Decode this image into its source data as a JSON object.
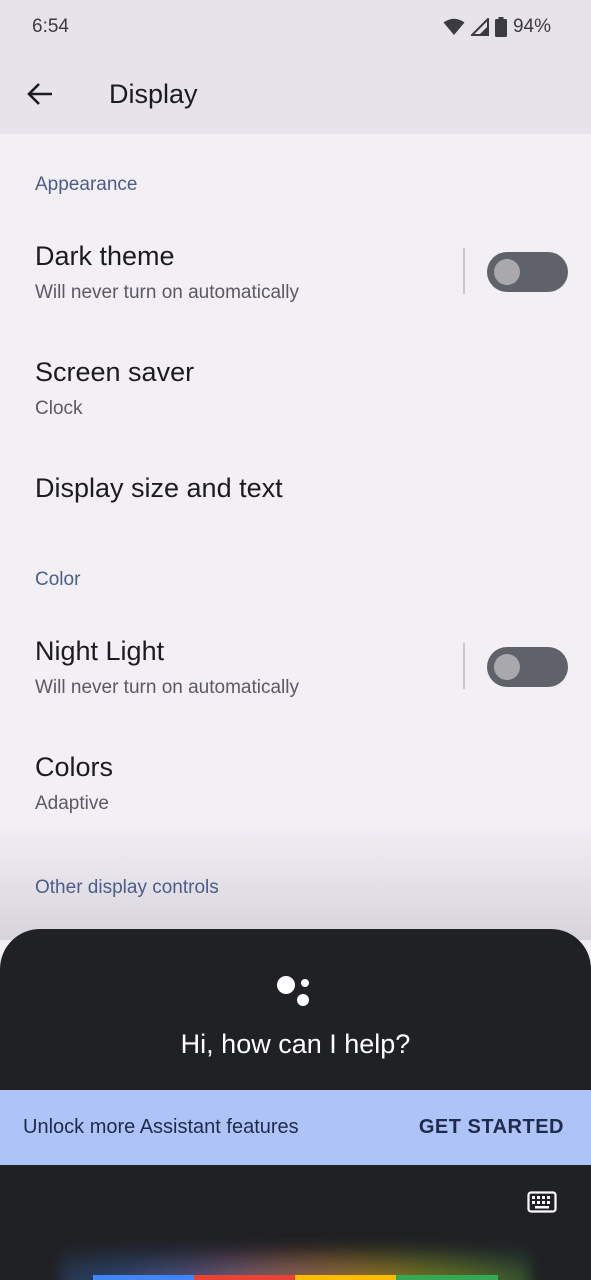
{
  "status_bar": {
    "time": "6:54",
    "battery": "94%",
    "icons": [
      "wifi-icon",
      "cell-signal-icon",
      "battery-icon"
    ]
  },
  "app_bar": {
    "title": "Display",
    "back_icon": "arrow-back-icon"
  },
  "sections": [
    {
      "header": "Appearance",
      "items": [
        {
          "title": "Dark theme",
          "summary": "Will never turn on automatically",
          "toggle": false
        },
        {
          "title": "Screen saver",
          "summary": "Clock"
        },
        {
          "title": "Display size and text",
          "summary": ""
        }
      ]
    },
    {
      "header": "Color",
      "items": [
        {
          "title": "Night Light",
          "summary": "Will never turn on automatically",
          "toggle": false
        },
        {
          "title": "Colors",
          "summary": "Adaptive"
        }
      ]
    },
    {
      "header": "Other display controls",
      "items": []
    }
  ],
  "assistant": {
    "greeting": "Hi, how can I help?",
    "banner_text": "Unlock more Assistant features",
    "banner_action": "GET STARTED",
    "keyboard_icon": "keyboard-icon",
    "colors": {
      "blue": "#4285f4",
      "red": "#ea4335",
      "yellow": "#fbbc04",
      "green": "#34a853"
    }
  },
  "colors": {
    "accent": "#4a5d8c",
    "switch_off_track": "#5f6269",
    "banner_bg": "#aec3f7",
    "sheet_bg": "#202124"
  }
}
